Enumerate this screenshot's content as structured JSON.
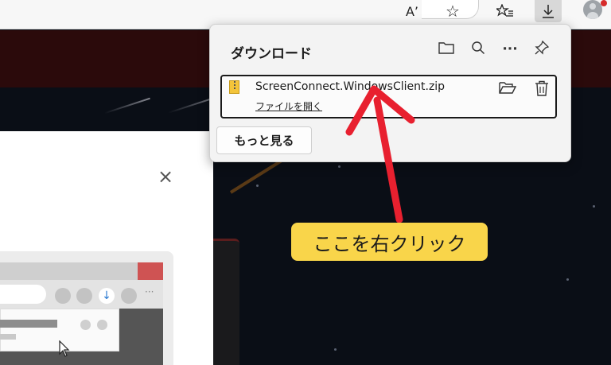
{
  "toolbar": {
    "icons": [
      "read-aloud-icon",
      "favorite-star-icon",
      "favorites-list-icon",
      "download-icon",
      "profile-avatar-icon"
    ],
    "read_aloud_glyph": "A’",
    "star_glyph": "☆",
    "favorites_glyph": "✩",
    "download_glyph": "↓"
  },
  "flyout": {
    "title": "ダウンロード",
    "icons": [
      "open-folder-icon",
      "search-icon",
      "more-options-icon",
      "pin-icon"
    ],
    "more_glyph": "···",
    "item": {
      "file_name": "ScreenConnect.WindowsClient.zip",
      "open_file": "ファイルを開く",
      "icons": [
        "zip-file-icon",
        "show-in-folder-icon",
        "delete-icon"
      ]
    },
    "more_button": "もっと見る"
  },
  "modal": {
    "close_glyph": "×"
  },
  "annotation": {
    "callout": "ここを右クリック",
    "arrow_color": "#e8202f",
    "callout_color": "#f9d54a"
  }
}
